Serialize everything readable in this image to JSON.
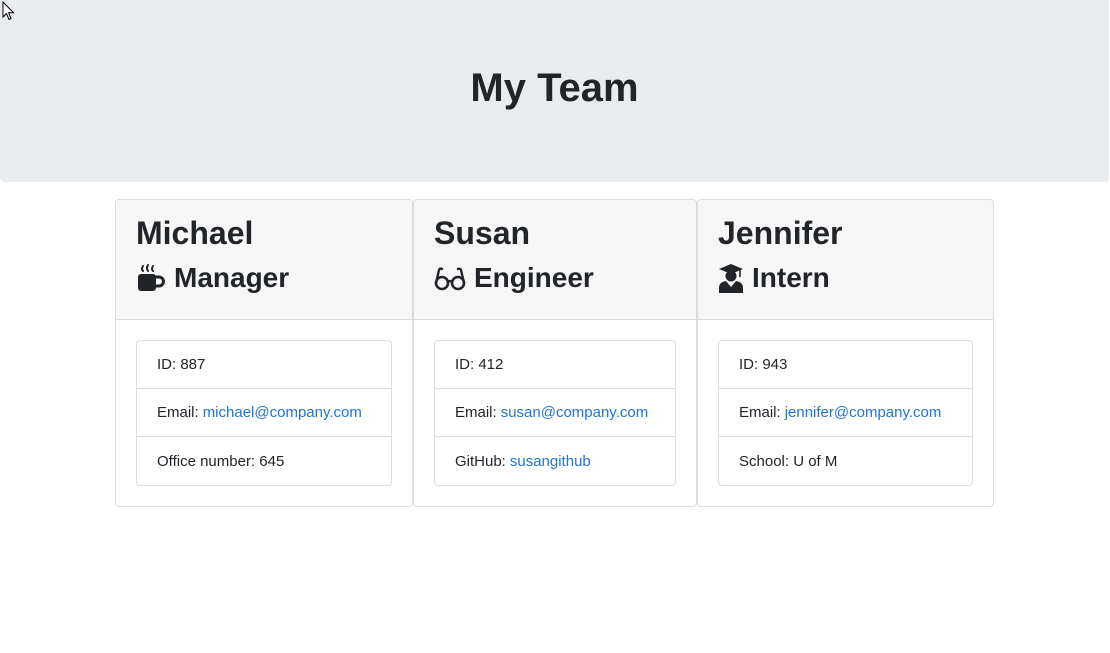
{
  "header": {
    "title": "My Team"
  },
  "team": [
    {
      "name": "Michael",
      "role": "Manager",
      "role_icon": "coffee-mug-icon",
      "id_label": "ID: 887",
      "email_label": "Email:",
      "email": "michael@company.com",
      "extra_label": "Office number: 645",
      "extra_link": ""
    },
    {
      "name": "Susan",
      "role": "Engineer",
      "role_icon": "glasses-icon",
      "id_label": "ID: 412",
      "email_label": "Email:",
      "email": "susan@company.com",
      "extra_label": "GitHub:",
      "extra_link": "susangithub"
    },
    {
      "name": "Jennifer",
      "role": "Intern",
      "role_icon": "graduate-icon",
      "id_label": "ID: 943",
      "email_label": "Email:",
      "email": "jennifer@company.com",
      "extra_label": "School: U of M",
      "extra_link": ""
    }
  ],
  "colors": {
    "link": "#1f74d8",
    "jumbotron": "#e9ecef",
    "card_header": "#f6f6f6"
  }
}
